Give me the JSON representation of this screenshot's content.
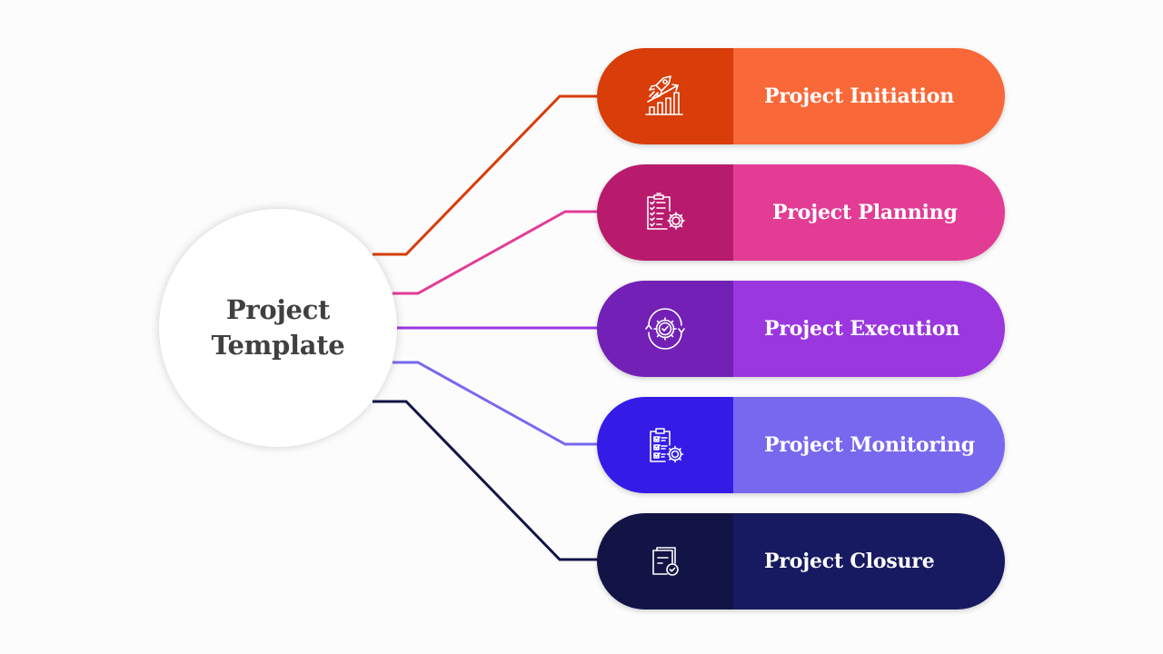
{
  "hub": {
    "title_line1": "Project",
    "title_line2": "Template"
  },
  "stages": [
    {
      "label": "Project Initiation",
      "icon": "rocket-growth-chart-icon",
      "icon_color": "#d83d0a",
      "label_color": "#f96838",
      "line_color": "#d83d0a"
    },
    {
      "label": "Project Planning",
      "icon": "clipboard-checklist-gear-icon",
      "icon_color": "#b81b6d",
      "label_color": "#e23c95",
      "line_color": "#e23c95"
    },
    {
      "label": "Project Execution",
      "icon": "gear-check-cycle-icon",
      "icon_color": "#7220b5",
      "label_color": "#9b37df",
      "line_color": "#9b37df"
    },
    {
      "label": "Project Monitoring",
      "icon": "clipboard-monitoring-gear-icon",
      "icon_color": "#341ce6",
      "label_color": "#7868ee",
      "line_color": "#7868ee"
    },
    {
      "label": "Project Closure",
      "icon": "documents-check-icon",
      "icon_color": "#121446",
      "label_color": "#171a61",
      "line_color": "#121446"
    }
  ]
}
